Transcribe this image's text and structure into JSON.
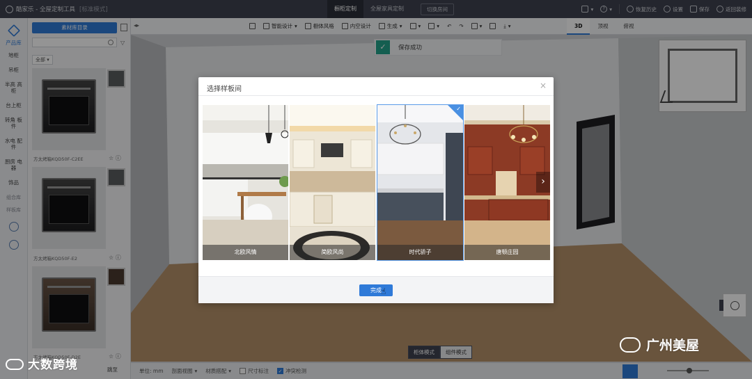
{
  "topbar": {
    "app_title": "酷家乐 - 全屋定制工具",
    "mode_label": "[标准模式]",
    "tab_active": "橱柜定制",
    "tab_other": "全屋家具定制",
    "switch_button": "切换房间",
    "restore_label": "恢复历史",
    "settings_label": "设置",
    "save_label": "保存",
    "return_label": "返回装修"
  },
  "rail": {
    "category_header": "产品库",
    "items": [
      "地柜",
      "吊柜",
      "半高 高柜",
      "台上柜",
      "转角 板件",
      "水电 配件",
      "厨房 电器",
      "饰品"
    ],
    "section_combo": "组合库",
    "section_template": "样板库"
  },
  "panel": {
    "primary_button": "素材库目录",
    "category_filter": "全部",
    "products": [
      {
        "name": "方太烤箱KQD50F-C2EE"
      },
      {
        "name": "方太烤箱KQD50F-E2"
      },
      {
        "name": "方太烤箱KQD50F-D2E"
      }
    ],
    "footer_link": "跳至"
  },
  "toolbar": {
    "smart_design": "智能设计",
    "cabinet_style": "橱体风格",
    "interior_design": "内空设计",
    "lift": "生成",
    "views": [
      "3D",
      "顶视",
      "俯视"
    ]
  },
  "toast": {
    "message": "保存成功"
  },
  "modes": {
    "cabinet": "柜体模式",
    "component": "组件模式"
  },
  "bottombar": {
    "unit": "单位: mm",
    "elevation": "剖面视图",
    "material_pair": "材质搭配",
    "dimension": "尺寸标注",
    "collision": "冲突检测"
  },
  "modal": {
    "title": "选择样板间",
    "done_button": "完成",
    "cards": [
      {
        "label": "北欧风情"
      },
      {
        "label": "简欧风尚"
      },
      {
        "label": "时代骄子"
      },
      {
        "label": "唐顿庄园"
      }
    ]
  },
  "watermark": {
    "left": "大数跨境",
    "right": "广州美屋"
  },
  "colors": {
    "accent": "#2f7ad8",
    "topbar": "#3e4250",
    "toast_ok": "#23a38a"
  }
}
